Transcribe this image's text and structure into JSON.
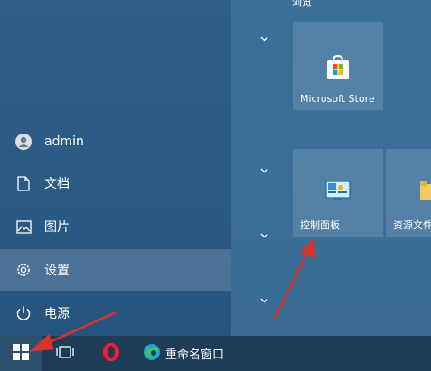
{
  "start_menu": {
    "user_name": "admin",
    "documents": "文档",
    "pictures": "图片",
    "settings": "设置",
    "power": "电源"
  },
  "tiles": {
    "group_label": "浏览",
    "microsoft_store": "Microsoft Store",
    "control_panel": "控制面板",
    "file_explorer": "资源文件"
  },
  "taskbar": {
    "rename_window": "重命名窗口"
  },
  "colors": {
    "annotation_arrow": "#d9342b",
    "accent": "#2d5f8a"
  },
  "icons": [
    "user-icon",
    "document-icon",
    "picture-icon",
    "gear-icon",
    "power-icon",
    "windows-icon",
    "task-view-icon",
    "opera-icon",
    "edge-icon",
    "store-icon",
    "control-panel-icon",
    "folder-icon",
    "chevron-down-icon"
  ]
}
